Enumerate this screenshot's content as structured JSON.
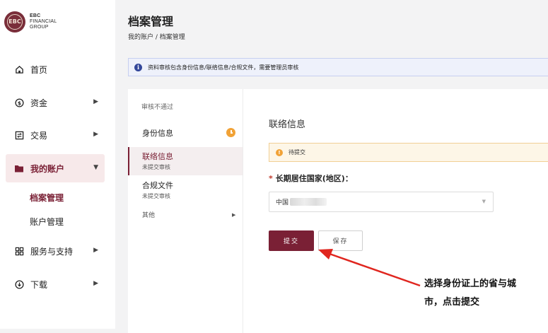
{
  "brand": {
    "badge": "EBC",
    "line1": "EBC",
    "line2": "FINANCIAL",
    "line3": "GROUP",
    "accent": "#7a2035"
  },
  "sidebar": {
    "items": [
      {
        "label": "首页",
        "icon": "home-icon"
      },
      {
        "label": "资金",
        "icon": "dollar-circle-icon"
      },
      {
        "label": "交易",
        "icon": "trade-icon"
      },
      {
        "label": "我的账户",
        "icon": "folder-icon"
      },
      {
        "label": "服务与支持",
        "icon": "grid-icon"
      },
      {
        "label": "下载",
        "icon": "download-icon"
      }
    ],
    "sub_items": [
      {
        "label": "档案管理"
      },
      {
        "label": "账户管理"
      }
    ]
  },
  "header": {
    "title": "档案管理",
    "breadcrumb": "我的账户 / 档案管理"
  },
  "notice": {
    "text": "资料审核包含身份信息/联络信息/合规文件，需要管理员审核"
  },
  "steps": {
    "status_header": "审核不通过",
    "items": [
      {
        "label": "身份信息",
        "sub": ""
      },
      {
        "label": "联络信息",
        "sub": "未提交审核"
      },
      {
        "label": "合规文件",
        "sub": "未提交审核"
      },
      {
        "label": "其他",
        "sub": ""
      }
    ]
  },
  "form": {
    "section_title": "联络信息",
    "status_text": "待提交",
    "field_label": "长期居住国家(地区)：",
    "required_mark": "*",
    "select_value": "中国",
    "submit_label": "提交",
    "save_label": "保存"
  },
  "annotation": {
    "line1": "选择身份证上的省与城",
    "line2": "市，点击提交",
    "color": "#e0261f"
  }
}
